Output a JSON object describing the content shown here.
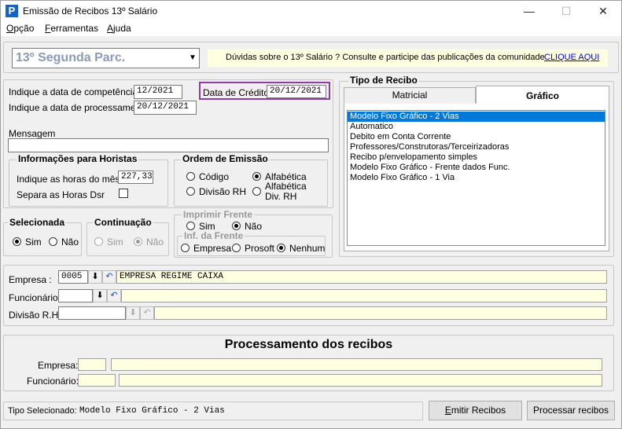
{
  "window": {
    "title": "Emissão de Recibos 13º Salário",
    "minimize": "—",
    "maximize": "☐",
    "close": "✕"
  },
  "menu": [
    {
      "label": "Opção",
      "accel": "O",
      "rest": "pção"
    },
    {
      "label": "Ferramentas",
      "accel": "F",
      "rest": "erramentas"
    },
    {
      "label": "Ajuda",
      "accel": "A",
      "rest": "juda"
    }
  ],
  "top": {
    "parcela_select": "13º Segunda Parc.",
    "duvidas_text": "Dúvidas sobre o 13º Salário ? Consulte e participe das publicações da comunidade",
    "clique_link": "CLIQUE AQUI"
  },
  "fields": {
    "competencia_label": "Indique a data de competência",
    "competencia_value": "12/2021",
    "processamento_label": "Indique a data de processamento",
    "processamento_value": "20/12/2021",
    "credito_label": "Data de Crédito",
    "credito_value": "20/12/2021",
    "mensagem_label": "Mensagem",
    "mensagem_value": ""
  },
  "horistas": {
    "title": "Informações para Horistas",
    "horas_label": "Indique as horas do mês",
    "horas_value": "227,33",
    "separa_label": "Separa as Horas Dsr"
  },
  "ordem": {
    "title": "Ordem de Emissão",
    "codigo": "Código",
    "alfabetica": "Alfabética",
    "divisao": "Divisão RH",
    "alfabetica_div_1": "Alfabética",
    "alfabetica_div_2": "Div.  RH"
  },
  "selecionada": {
    "title": "Selecionada",
    "sim": "Sim",
    "nao": "Não"
  },
  "continuacao": {
    "title": "Continuação",
    "sim": "Sim",
    "nao": "Não"
  },
  "imprimir": {
    "title": "Imprimir Frente",
    "sim": "Sim",
    "nao": "Não",
    "inf_title": "Inf. da Frente",
    "empresa": "Empresa",
    "prosoft": "Prosoft",
    "nenhum": "Nenhum"
  },
  "tipo_recibo": {
    "title": "Tipo de Recibo",
    "tab_matricial": "Matricial",
    "tab_grafico": "Gráfico",
    "items": [
      "Modelo Fixo Gráfico - 2 Vias",
      "Automatico",
      "Debito em Conta Corrente",
      "Professores/Construtoras/Terceirizadoras",
      "Recibo p/envelopamento simples",
      "Modelo Fixo Gráfico - Frente dados Func.",
      "Modelo Fixo Gráfico - 1 Via"
    ]
  },
  "empresa_panel": {
    "empresa_label": "Empresa :",
    "empresa_code": "0005",
    "empresa_name": "EMPRESA REGIME CAIXA",
    "funcionario_label": "Funcionário :",
    "funcionario_code": "",
    "funcionario_name": "",
    "divisao_label": "Divisão R.H.:",
    "divisao_code": "",
    "divisao_name": ""
  },
  "processamento": {
    "title": "Processamento dos recibos",
    "empresa_label": "Empresa:",
    "funcionario_label": "Funcionário:"
  },
  "footer": {
    "tipo_label": "Tipo Selecionado:",
    "tipo_value": "Modelo Fixo Gráfico - 2 Vias",
    "emitir": "Emitir Recibos",
    "processar": "Processar recibos"
  }
}
